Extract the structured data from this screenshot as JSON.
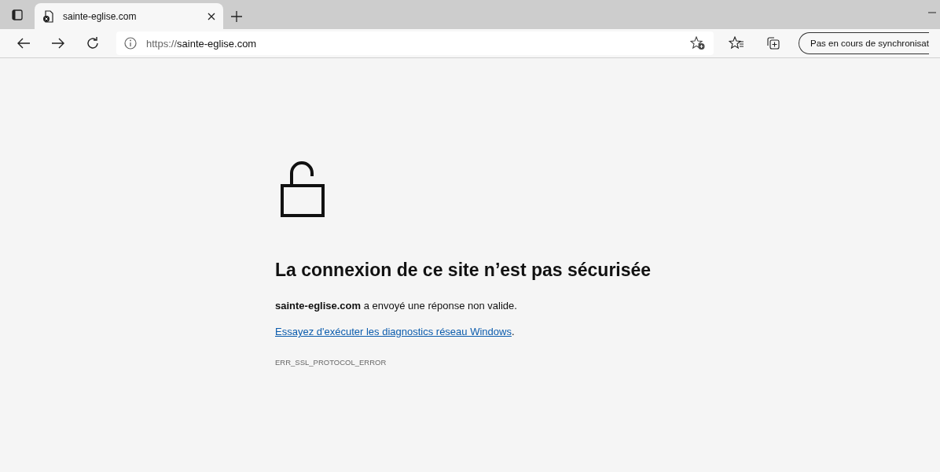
{
  "tabs": [
    {
      "title": "sainte-eglise.com",
      "selected": true
    }
  ],
  "address_bar": {
    "scheme": "https://",
    "host": "sainte-eglise.com"
  },
  "sync_button": {
    "label": "Pas en cours de synchronisat"
  },
  "error": {
    "title": "La connexion de ce site n’est pas sécurisée",
    "message": "**sainte-eglise.com** a envoyé une réponse non valide.",
    "link": "Essayez d'exécuter les diagnostics réseau Windows",
    "link_suffix": ".",
    "code": "ERR_SSL_PROTOCOL_ERROR"
  }
}
